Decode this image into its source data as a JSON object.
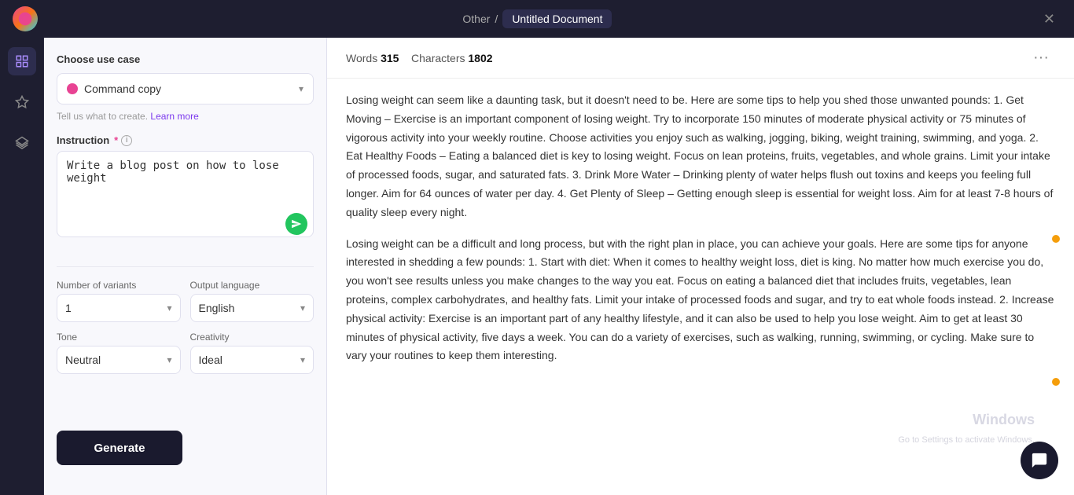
{
  "topbar": {
    "breadcrumb_prefix": "Other",
    "separator": "/",
    "doc_title": "Untitled Document",
    "close_label": "✕"
  },
  "left_panel": {
    "choose_use_case_label": "Choose use case",
    "use_case_value": "Command copy",
    "helper_text": "Tell us what to create.",
    "learn_more_label": "Learn more",
    "instruction_label": "Instruction",
    "instruction_placeholder": "Write a blog post on how to lose weight",
    "number_of_variants_label": "Number of variants",
    "variants_value": "1",
    "output_language_label": "Output language",
    "output_language_value": "English",
    "tone_label": "Tone",
    "tone_value": "Neutral",
    "creativity_label": "Creativity",
    "creativity_value": "Ideal",
    "generate_label": "Generate"
  },
  "content_header": {
    "words_label": "Words",
    "words_count": "315",
    "characters_label": "Characters",
    "characters_count": "1802"
  },
  "content": {
    "paragraphs": [
      "Losing weight can seem like a daunting task, but it doesn't need to be. Here are some tips to help you shed those unwanted pounds:\n1. Get Moving – Exercise is an important component of losing weight. Try to incorporate 150 minutes of moderate physical activity or 75 minutes of vigorous activity into your weekly routine. Choose activities you enjoy such as walking, jogging, biking, weight training, swimming, and yoga.\n2. Eat Healthy Foods – Eating a balanced diet is key to losing weight. Focus on lean proteins, fruits, vegetables, and whole grains. Limit your intake of processed foods, sugar, and saturated fats.\n3. Drink More Water – Drinking plenty of water helps flush out toxins and keeps you feeling full longer. Aim for 64 ounces of water per day.\n4. Get Plenty of Sleep – Getting enough sleep is essential for weight loss. Aim for at least 7-8 hours of quality sleep every night.",
      "Losing weight can be a difficult and long process, but with the right plan in place, you can achieve your goals. Here are some tips for anyone interested in shedding a few pounds:\n1. Start with diet: When it comes to healthy weight loss, diet is king. No matter how much exercise you do, you won't see results unless you make changes to the way you eat. Focus on eating a balanced diet that includes fruits, vegetables, lean proteins, complex carbohydrates, and healthy fats. Limit your intake of processed foods and sugar, and try to eat whole foods instead.\n2. Increase physical activity: Exercise is an important part of any healthy lifestyle, and it can also be used to help you lose weight. Aim to get at least 30 minutes of physical activity, five days a week. You can do a variety of exercises, such as walking, running, swimming, or cycling. Make sure to vary your routines to keep them interesting."
    ]
  },
  "sidebar_icons": [
    {
      "name": "grid-icon",
      "symbol": "⊞",
      "active": true
    },
    {
      "name": "star-icon",
      "symbol": "✦",
      "active": false
    },
    {
      "name": "layers-icon",
      "symbol": "◈",
      "active": false
    }
  ]
}
